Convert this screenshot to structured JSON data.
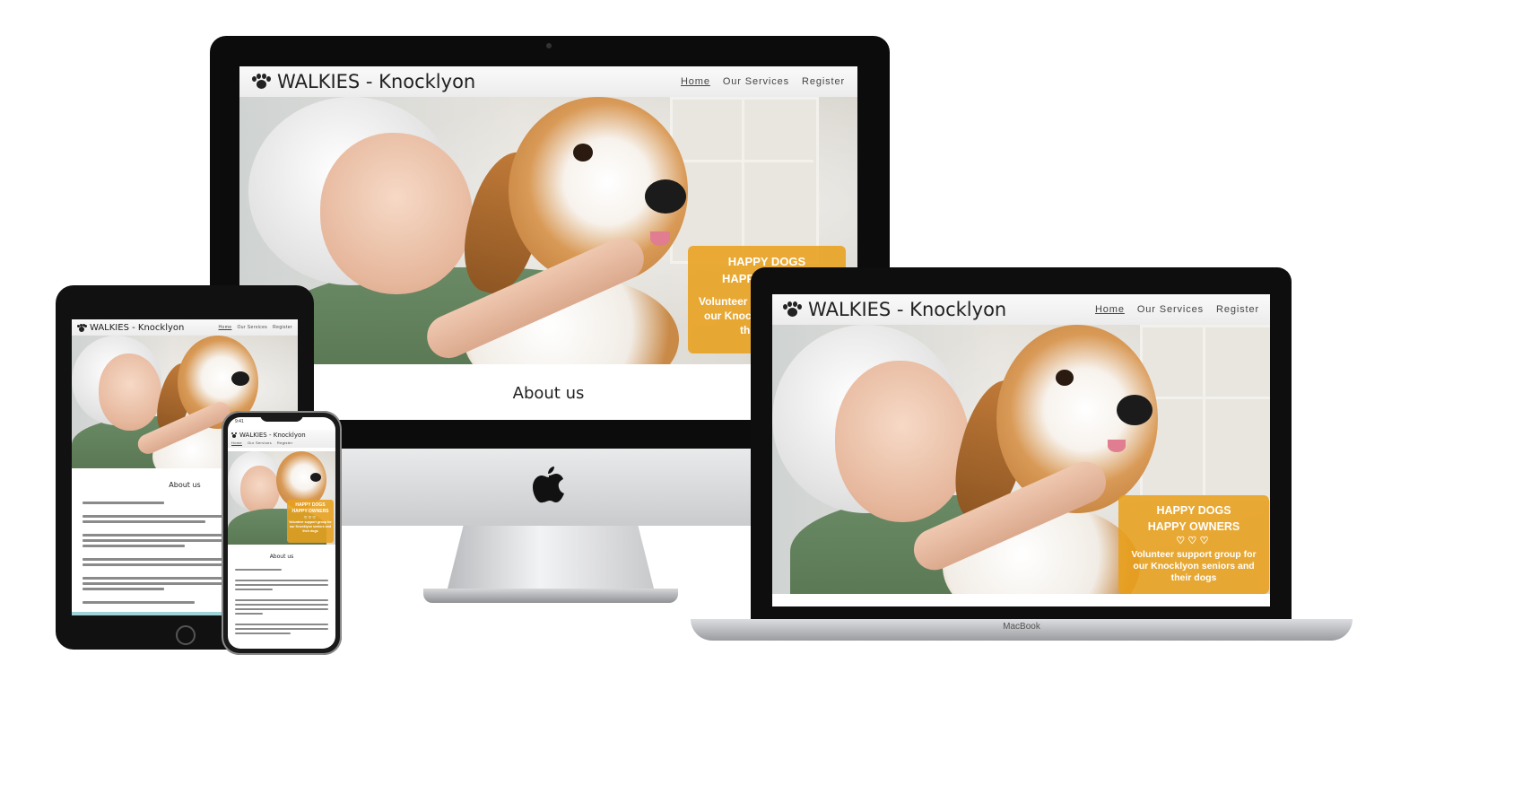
{
  "site": {
    "brand": "WALKIES - Knocklyon",
    "nav": [
      {
        "label": "Home",
        "active": true
      },
      {
        "label": "Our Services",
        "active": false
      },
      {
        "label": "Register",
        "active": false
      }
    ],
    "hero_line1": "HAPPY DOGS",
    "hero_line2": "HAPPY OWNERS",
    "hearts": "♡♡♡",
    "hero_tagline": "Volunteer support group for our Knocklyon seniors and their dogs",
    "about_title": "About us",
    "accent_color": "#e8a01c"
  },
  "devices": {
    "macbook_label": "MacBook",
    "iphone_time": "9:41"
  },
  "imac_partial": {
    "line1": "HAPPY DOGS",
    "line2": "HAPP",
    "line3": "Volunteer",
    "line4": "our Knoc",
    "line5": "th"
  }
}
